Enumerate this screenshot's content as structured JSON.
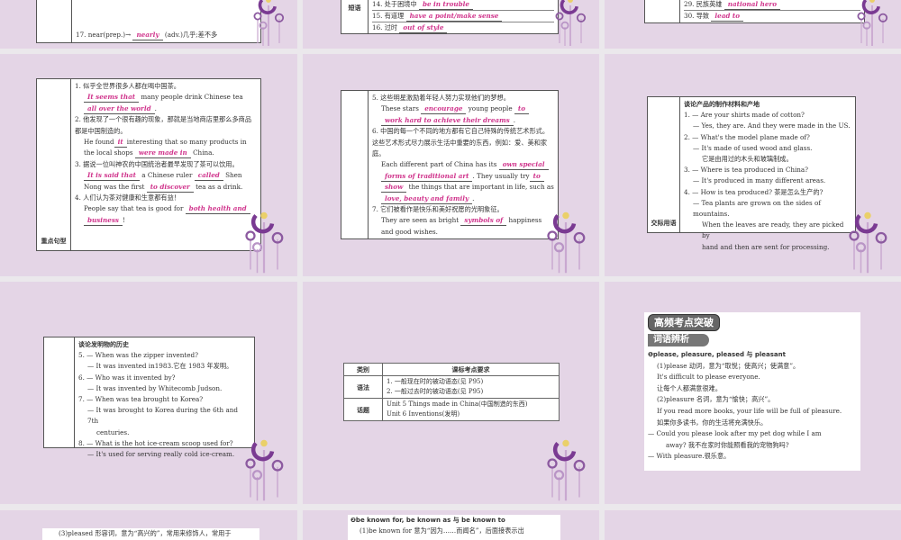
{
  "colors": {
    "panel_bg": "#e4d5e6",
    "answer": "#d0348c",
    "gap": "#ebe8ec"
  },
  "r1": {
    "p1": {
      "line": [
        "17. near(prep.)→",
        "nearly",
        "(adv.)几乎;差不多"
      ]
    },
    "p2": {
      "label": "短语",
      "items": [
        [
          "14. 处于困境中",
          "be in trouble"
        ],
        [
          "15. 有道理",
          "have a point/make sense"
        ],
        [
          "16. 过时",
          "out of style"
        ]
      ]
    },
    "p3": {
      "items": [
        [
          "29. 民族英雄",
          "national hero"
        ],
        [
          "30. 导致",
          "lead to"
        ]
      ]
    }
  },
  "r2": {
    "p1": {
      "label": "重点句型",
      "s1_cn": "1. 似乎全世界很多人都在喝中国茶。",
      "s1_a1": "It seems that",
      "s1_t1": "many people drink Chinese tea",
      "s1_a2": "all over the world",
      "s1_t2": ".",
      "s2_cn": "2. 他发现了一个很有趣的现象，那就是当地商店里那么多商品都是中国制造的。",
      "s2_t1": "He found",
      "s2_a1": "it",
      "s2_t2": "interesting that so many products in the local shops",
      "s2_a2": "were made in",
      "s2_t3": "China.",
      "s3_cn": "3. 据说一位叫神农的中国统治者最早发现了茶可以饮用。",
      "s3_a1": "It is said that",
      "s3_t1": "a Chinese ruler",
      "s3_a2": "called",
      "s3_t2": "Shen Nong was the first",
      "s3_a3": "to discover",
      "s3_t3": "tea as a drink.",
      "s4_cn": "4. 人们认为茶对健康和生意都有益！",
      "s4_t1": "People say that tea is good for",
      "s4_a1": "both health and",
      "s4_a2": "business",
      "s4_t2": "!"
    },
    "p2": {
      "s5_cn": "5. 这些明星激励着年轻人努力实现他们的梦想。",
      "s5_t1": "These stars",
      "s5_a1": "encourage",
      "s5_t2": "young people",
      "s5_a2": "to",
      "s5_a3": "work hard to achieve their dreams",
      "s5_t3": ".",
      "s6_cn": "6. 中国的每一个不同的地方都有它自己特殊的传统艺术形式。这些艺术形式尽力展示生活中重要的东西，例如：爱、美和家庭。",
      "s6_t1": "Each different part of China has its",
      "s6_a1": "own special",
      "s6_a2": "forms of traditional art",
      "s6_t2": ". They usually try",
      "s6_a3": "to",
      "s6_a4": "show",
      "s6_t3": "the things that are important in life, such as",
      "s6_a5": "love, beauty and family",
      "s6_t4": ".",
      "s7_cn": "7. 它们被看作是快乐和美好祝愿的光明象征。",
      "s7_t1": "They are seen as bright",
      "s7_a1": "symbols of",
      "s7_t2": "happiness and good wishes."
    },
    "p3": {
      "label": "交际用语",
      "title": "谈论产品的制作材料和产地",
      "lines": [
        "1. — Are your shirts made of cotton?",
        "— Yes, they are. And they were made in the US.",
        "2. — What's the model plane made of?",
        "— It's made of used wood and glass.",
        "它是由用过的木头和玻璃制成。",
        "3. — Where is tea produced in China?",
        "— It's produced in many different areas.",
        "4. — How is tea produced? 茶是怎么生产的?",
        "— Tea plants are grown on the sides of mountains.",
        "When the leaves are ready, they are picked by",
        "hand and then are sent for processing."
      ]
    }
  },
  "r3": {
    "p1": {
      "title": "谈论发明物的历史",
      "lines": [
        "5. — When was the zipper invented?",
        "— It was invented in1983.它在 1983 年发明。",
        "6. — Who was it invented by?",
        "— It was invented by Whitecomb Judson.",
        "7. — When was tea brought to Korea?",
        "— It was brought to Korea during the 6th and 7th",
        "centuries.",
        "8. — What is the hot ice-cream scoop used for?",
        "— It's used for serving really cold ice-cream."
      ]
    },
    "p2": {
      "h1": "类别",
      "h2": "课标考点要求",
      "r1_label": "语法",
      "r1_l1": "1. 一般现在时的被动语态(见 P95)",
      "r1_l2": "2. 一般过去时的被动语态(见 P95)",
      "r2_label": "话题",
      "r2_l1": "Unit 5 Things made in China(中国制造的东西)",
      "r2_l2": "Unit 6 Inventions(发明)"
    },
    "p3": {
      "banner": "高频考点突破",
      "subtitle": "词语辨析",
      "heading": "❶please, pleasure, pleased 与 pleasant",
      "lines": [
        "(1)please 动词，意为“取悦；使高兴；使满意”。",
        "It's difficult to please everyone.",
        "让每个人都满意很难。",
        "(2)pleasure 名词，意为“愉快；高兴”。",
        "If you read more books, your life will be full of pleasure.",
        "如果你多读书，你的生活将充满快乐。",
        "— Could you please look after my pet dog while I am",
        "away? 我不在家时你能照看我的宠物狗吗?",
        "— With pleasure.很乐意。"
      ]
    }
  },
  "r4": {
    "p1": {
      "line": "(3)pleased 形容词，意为“高兴的”，常用来修饰人，常用于"
    },
    "p2": {
      "heading": "❷be known for, be known as 与 be known to",
      "line": "(1)be known for 意为“因为……而闻名”，后面接表示出"
    }
  }
}
